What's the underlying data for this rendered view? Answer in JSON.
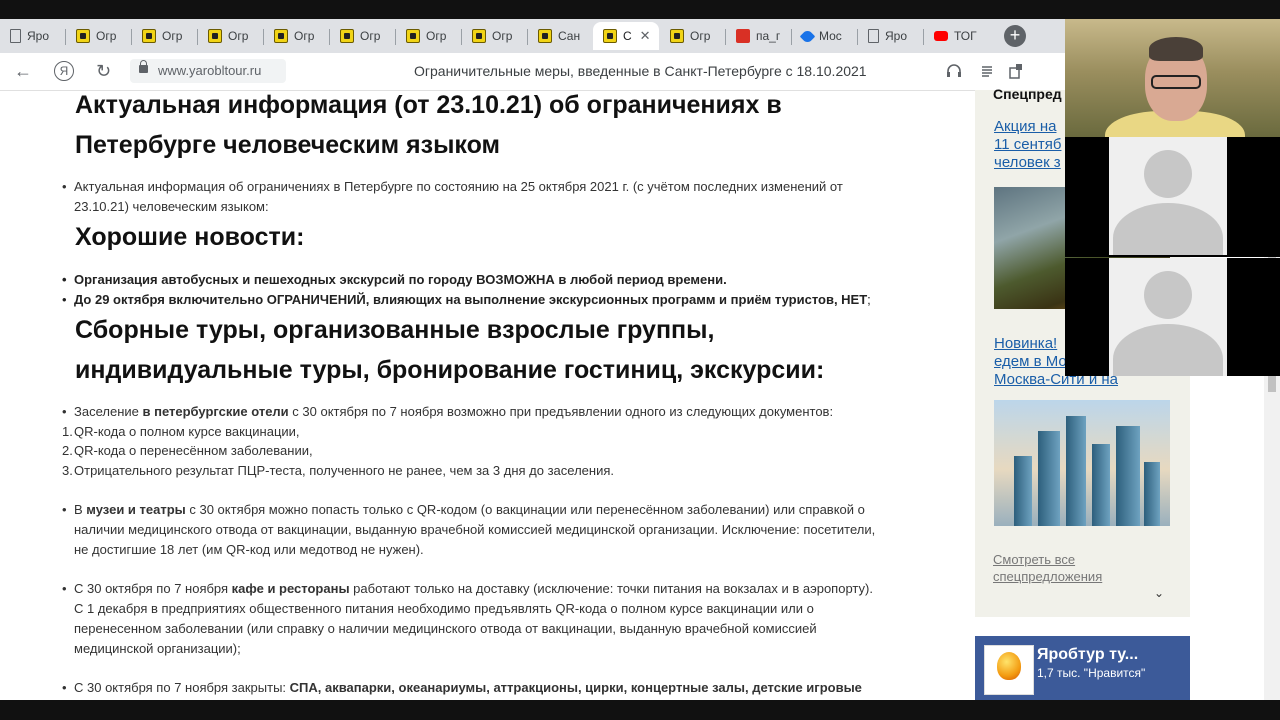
{
  "browser": {
    "tabs": [
      {
        "label": "Яро",
        "icon": "page-icon"
      },
      {
        "label": "Огр",
        "icon": "yarobltour-icon"
      },
      {
        "label": "Огр",
        "icon": "yarobltour-icon"
      },
      {
        "label": "Огр",
        "icon": "yarobltour-icon"
      },
      {
        "label": "Огр",
        "icon": "yarobltour-icon"
      },
      {
        "label": "Огр",
        "icon": "yarobltour-icon"
      },
      {
        "label": "Огр",
        "icon": "yarobltour-icon"
      },
      {
        "label": "Огр",
        "icon": "yarobltour-icon"
      },
      {
        "label": "Сан",
        "icon": "yarobltour-icon"
      },
      {
        "label": "С",
        "icon": "yarobltour-icon",
        "active": true
      },
      {
        "label": "Огр",
        "icon": "yarobltour-icon"
      },
      {
        "label": "па_г",
        "icon": "castle-icon"
      },
      {
        "label": "Мос",
        "icon": "pin-icon"
      },
      {
        "label": "Яро",
        "icon": "page-icon"
      },
      {
        "label": "ТОГ",
        "icon": "youtube-icon"
      }
    ],
    "new_tab": "+",
    "close_tab": "✕",
    "address": "www.yarobltour.ru",
    "page_title": "Ограничительные меры, введенные в Санкт-Петербурге с 18.10.2021",
    "nav": {
      "back": "←",
      "yandex": "Я",
      "reload": "↻"
    }
  },
  "main": {
    "heading1": [
      "Актуальная информация (от 23.10.21) об ограничениях в",
      "Петербурге человеческим языком"
    ],
    "intro": [
      "Актуальная информация об ограничениях в Петербурге по состоянию на 25 октября 2021 г. (с учётом последних изменений от",
      "23.10.21) человеческим языком:"
    ],
    "heading2": "Хорошие новости:",
    "good_news": [
      "Организация автобусных и пешеходных экскурсий по городу ВОЗМОЖНА в любой период времени.",
      "До 29 октября включительно ОГРАНИЧЕНИЙ, влияющих на выполнение экскурсионных программ и приём туристов, НЕТ"
    ],
    "good_news_tail": ";",
    "heading3": [
      "Сборные туры, организованные взрослые группы,",
      "индивидуальные туры, бронирование гостиниц, экскурсии:"
    ],
    "hotels": {
      "pre": "Заселение ",
      "bold": "в петербургские отели",
      "post": " с 30 октября по 7 ноября возможно при предъявлении одного из следующих документов:"
    },
    "hotel_docs": [
      "QR-кода о полном курсе вакцинации,",
      "QR-кода о перенесённом заболевании,",
      "Отрицательного результат ПЦР-теста, полученного не ранее, чем за 3 дня до заселения."
    ],
    "museums": {
      "pre": "В ",
      "bold": "музеи и театры",
      "lines": [
        " с 30 октября можно попасть только с QR-кодом (о вакцинации или перенесённом заболевании) или справкой о",
        "наличии медицинского отвода от вакцинации, выданную врачебной комиссией медицинской организации. Исключение: посетители,",
        "не достигшие 18 лет (им QR-код или медотвод не нужен)."
      ]
    },
    "cafes": {
      "pre": "С 30 октября по 7 ноября ",
      "bold": "кафе и рестораны",
      "post": " работают только на доставку (исключение: точки питания на вокзалах и в аэропорту).",
      "lines": [
        "С 1 декабря в предприятиях общественного питания необходимо предъявлять QR-кода о полном курсе вакцинации или о",
        "перенесенном заболевании (или справку о наличии медицинского отвода от вакцинации, выданную врачебной комиссией",
        "медицинской организации);"
      ]
    },
    "closed": {
      "pre": "С 30 октября по 7 ноября закрыты: ",
      "bold": "СПА, аквапарки, океанариумы, аттракционы, цирки, концертные залы, детские игровые"
    }
  },
  "sidebar": {
    "title": "Спецпред",
    "offer1": [
      "Акция на",
      "11 сентяб",
      "человек з"
    ],
    "offer2": [
      "Новинка! ",
      "едем в Мо",
      "Москва-Сити и на"
    ],
    "see_all": [
      "Смотреть все",
      "спецпредложения"
    ],
    "chevron": "⌄"
  },
  "facebook_widget": {
    "name": "Яробтур ту...",
    "likes": "1,7 тыс. \"Нравится\""
  },
  "colors": {
    "link": "#1a5ea8",
    "sidebar_bg": "#f1f1ea",
    "fb_blue": "#3c5a99",
    "tab_yellow": "#f1d416"
  }
}
